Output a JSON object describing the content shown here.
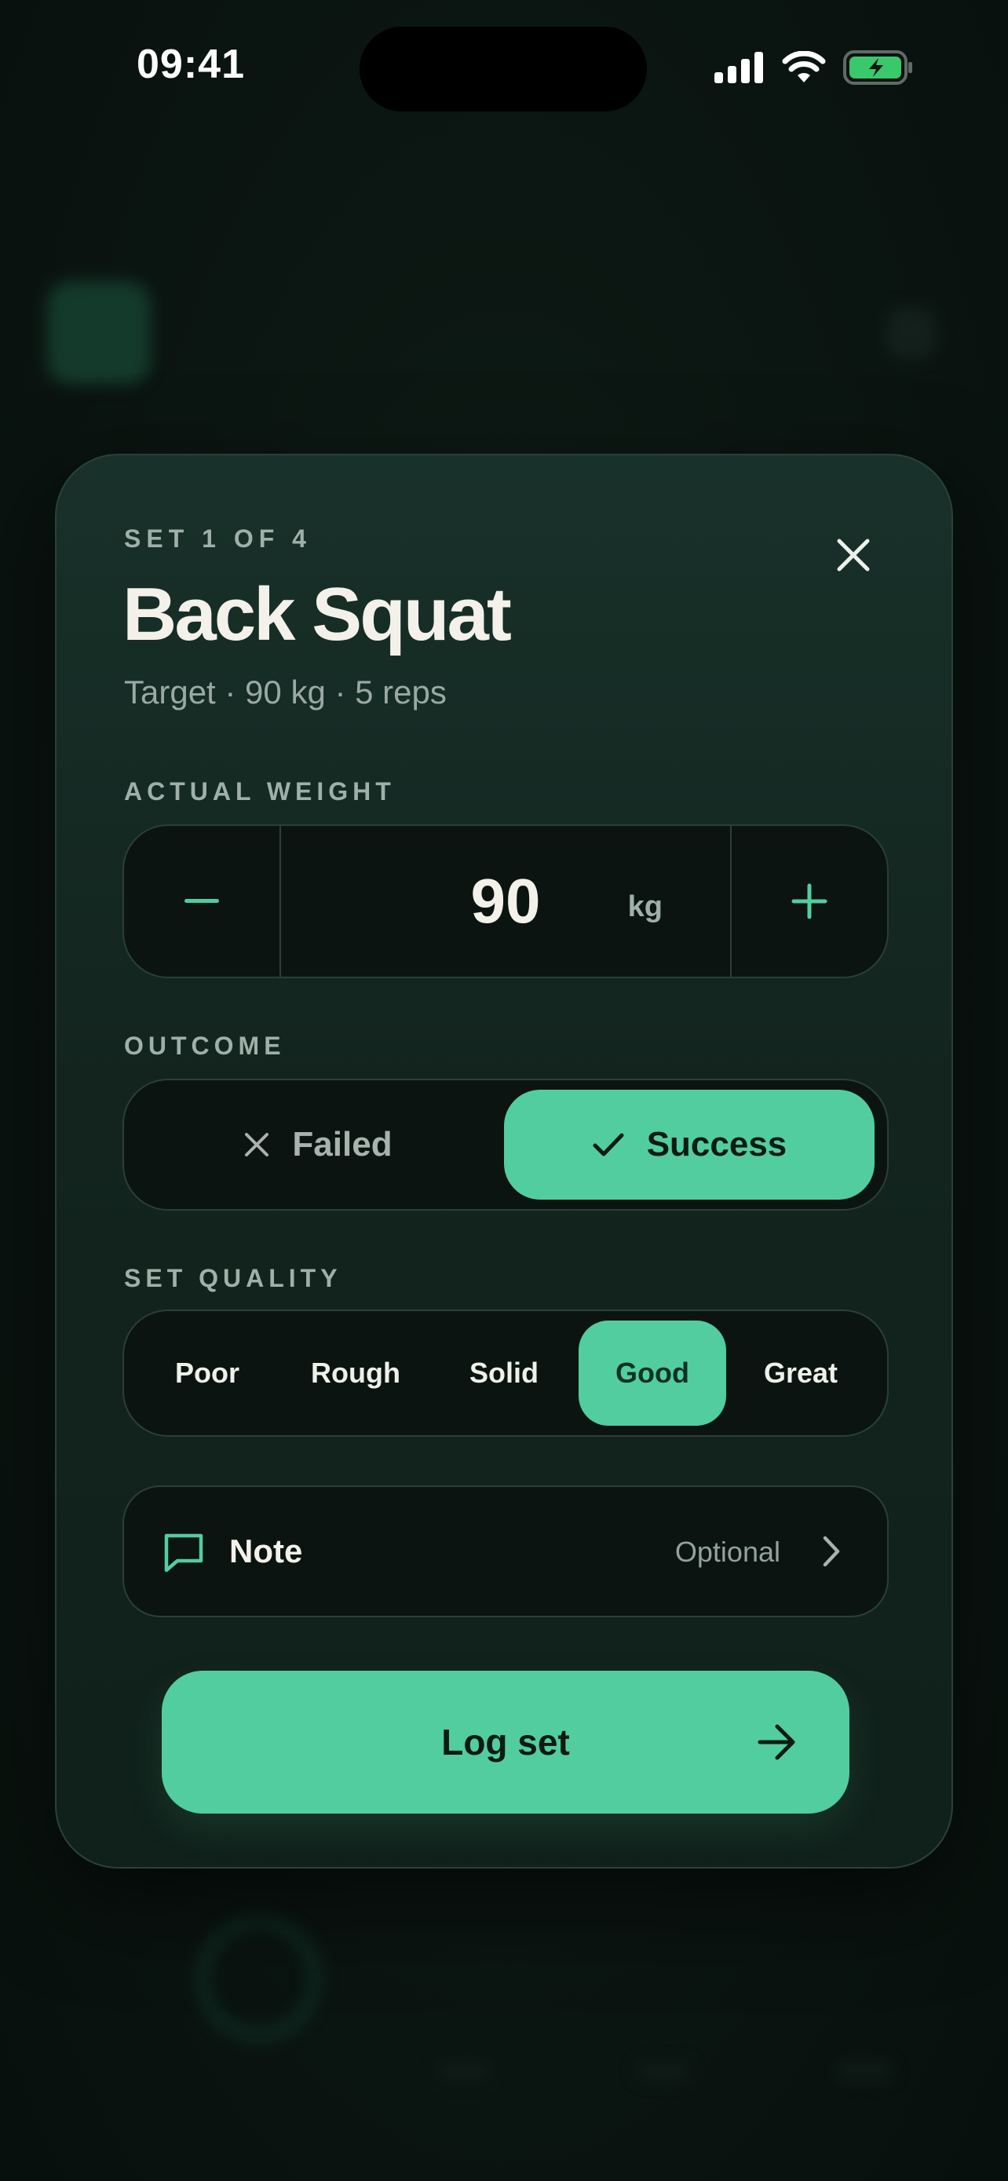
{
  "status_bar": {
    "time": "09:41"
  },
  "sheet": {
    "kicker": "SET 1 OF 4",
    "title": "Back Squat",
    "subtitle": "Target · 90 kg · 5 reps"
  },
  "weight": {
    "label": "ACTUAL WEIGHT",
    "value": "90",
    "unit": "kg"
  },
  "outcome": {
    "label": "OUTCOME",
    "options": [
      "Failed",
      "Success"
    ],
    "selected": "Success"
  },
  "quality": {
    "label": "SET QUALITY",
    "options": [
      "Poor",
      "Rough",
      "Solid",
      "Good",
      "Great"
    ],
    "selected": "Good"
  },
  "note": {
    "label": "Note",
    "hint": "Optional"
  },
  "cta": {
    "label": "Log set"
  },
  "colors": {
    "accent": "#52cd9f",
    "sheet_bg": "#13241e",
    "field_bg": "#0b1411",
    "text_primary": "#f3f1ea",
    "text_muted": "#9fb0a8"
  },
  "icons": [
    "signal-icon",
    "wifi-icon",
    "battery-charging-icon",
    "close-icon",
    "minus-icon",
    "plus-icon",
    "x-icon",
    "check-icon",
    "chat-bubble-icon",
    "chevron-right-icon",
    "arrow-right-icon"
  ]
}
